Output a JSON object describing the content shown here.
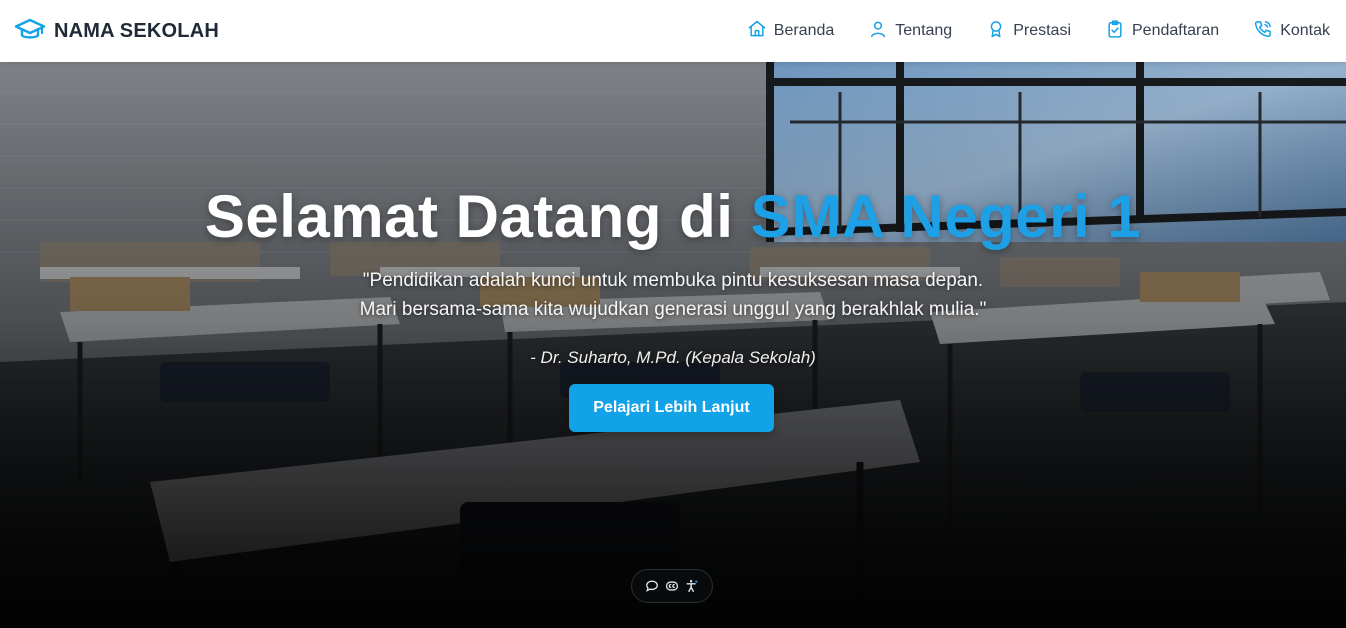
{
  "brand": {
    "name": "NAMA SEKOLAH",
    "icon": "graduation-cap-icon"
  },
  "nav": [
    {
      "label": "Beranda",
      "icon": "home-icon"
    },
    {
      "label": "Tentang",
      "icon": "user-icon"
    },
    {
      "label": "Prestasi",
      "icon": "award-icon"
    },
    {
      "label": "Pendaftaran",
      "icon": "clipboard-check-icon"
    },
    {
      "label": "Kontak",
      "icon": "phone-icon"
    }
  ],
  "hero": {
    "title_prefix": "Selamat Datang di",
    "title_accent": "SMA Negeri 1",
    "quote_line1": "\"Pendidikan adalah kunci untuk membuka pintu kesuksesan masa depan.",
    "quote_line2": "Mari bersama-sama kita wujudkan generasi unggul yang berakhlak mulia.\"",
    "author": "- Dr. Suharto, M.Pd. (Kepala Sekolah)",
    "cta_label": "Pelajari Lebih Lanjut"
  },
  "toolbar": [
    {
      "icon": "chat-bubble-icon"
    },
    {
      "icon": "closed-captions-icon"
    },
    {
      "icon": "accessibility-icon"
    }
  ],
  "colors": {
    "accent": "#1ea0e6",
    "cta": "#12a2e8",
    "navbar_bg": "#ffffff",
    "nav_icon": "#12a2e8"
  }
}
